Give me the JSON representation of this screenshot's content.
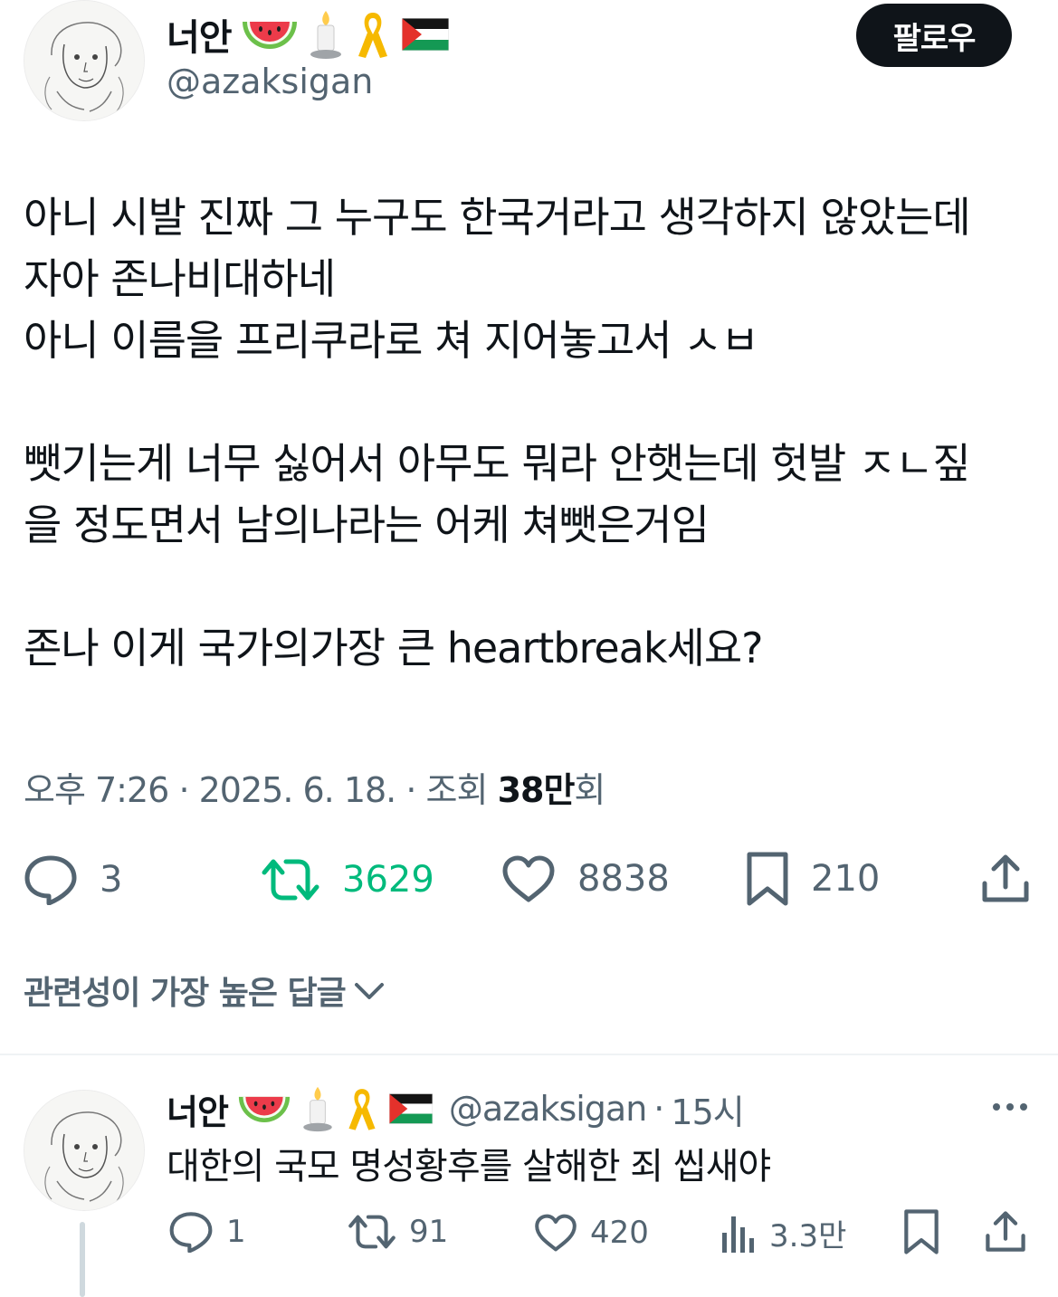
{
  "author": {
    "display_name": "너안",
    "handle": "@azaksigan",
    "emojis": [
      "watermelon-emoji",
      "candle-emoji",
      "yellow-ribbon-emoji",
      "palestine-flag-emoji"
    ]
  },
  "follow_button": {
    "label": "팔로우"
  },
  "tweet": {
    "text": "아니 시발 진짜 그 누구도 한국거라고 생각하지 않았는데\n자아 존나비대하네\n아니 이름을 프리쿠라로 쳐 지어놓고서 ㅅㅂ\n\n뺏기는게 너무 싫어서 아무도 뭐라 안햇는데 헛발 ㅈㄴ짚\n을 정도면서 남의나라는 어케 쳐뺏은거임\n\n존나 이게 국가의가장 큰 heartbreak세요?",
    "time": "오후 7:26",
    "separator": "·",
    "date": "2025. 6. 18.",
    "views_label": "조회",
    "views_value": "38만",
    "views_suffix": "회"
  },
  "actions": {
    "reply_count": "3",
    "retweet_count": "3629",
    "like_count": "8838",
    "bookmark_count": "210"
  },
  "sort": {
    "label": "관련성이 가장 높은 답글"
  },
  "reply": {
    "display_name": "너안",
    "handle": "@azaksigan",
    "separator": "·",
    "time": "15시",
    "text": "대한의 국모 명성황후를 살해한 죄 씹새야",
    "reply_count": "1",
    "retweet_count": "91",
    "like_count": "420",
    "views_count": "3.3만"
  },
  "colors": {
    "retweet_active": "#00ba7c",
    "muted": "#536471",
    "text": "#0f1419",
    "follow_bg": "#0f1419"
  }
}
